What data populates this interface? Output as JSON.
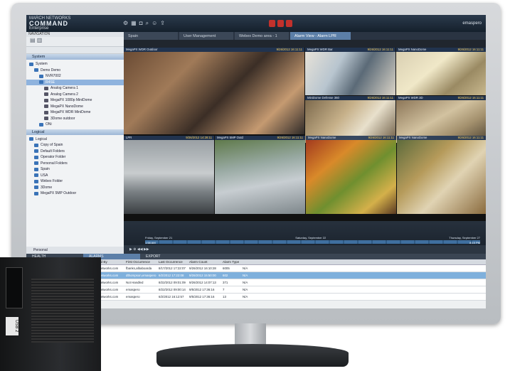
{
  "app": {
    "brand_line1": "MARCH NETWORKS",
    "brand_line2": "COMMAND",
    "brand_line3": "Enterprise",
    "user": "emaspero"
  },
  "tabs": [
    "Spain",
    "User Management",
    "Webex Demo area - 1",
    "Alarm View - Alarm LPR"
  ],
  "navigation": {
    "title": "NAVIGATION",
    "system_section": "System",
    "system_tree": [
      {
        "label": "System",
        "level": 0
      },
      {
        "label": "Demo Demo",
        "level": 1
      },
      {
        "label": "NVR7002",
        "level": 2
      },
      {
        "label": "R4SE",
        "level": 2
      },
      {
        "label": "Analog Camera 1",
        "level": 3
      },
      {
        "label": "Analog Camera 2",
        "level": 3
      },
      {
        "label": "MegaPX 1080p MiniDome",
        "level": 3
      },
      {
        "label": "MegaPX NanoDome",
        "level": 3
      },
      {
        "label": "MegaPX WDR MiniDome",
        "level": 3
      },
      {
        "label": "3Dome outdoor",
        "level": 3
      },
      {
        "label": "ONi",
        "level": 2
      }
    ],
    "system_selected_index": 3,
    "logical_section": "Logical",
    "logical_tree": [
      {
        "label": "Logical",
        "level": 0
      },
      {
        "label": "Copy of Spain",
        "level": 1
      },
      {
        "label": "Default Folders",
        "level": 1
      },
      {
        "label": "Operator Folder",
        "level": 1
      },
      {
        "label": "Personal Folders",
        "level": 1
      },
      {
        "label": "Spain",
        "level": 1
      },
      {
        "label": "USA",
        "level": 1
      },
      {
        "label": "Webex Folder",
        "level": 1
      },
      {
        "label": "3Dome",
        "level": 1
      },
      {
        "label": "MegaPX 5MP Outdoor",
        "level": 1
      }
    ],
    "footer": "Personal"
  },
  "video_tiles": [
    {
      "name": "MegaPX WDR Outdoor",
      "time": "9/26/2012 16:11:11"
    },
    {
      "name": "MegaPX WDR Bar",
      "time": "9/26/2012 16:11:11"
    },
    {
      "name": "MegaPX NanoDome",
      "time": "9/26/2012 16:11:11"
    },
    {
      "name": "MiniDome Defense 360",
      "time": "9/26/2012 16:11:11"
    },
    {
      "name": "MegaPX WDR 3D",
      "time": "9/26/2012 16:11:11"
    },
    {
      "name": "LPR",
      "time": "9/26/2012 14:28:11"
    },
    {
      "name": "MegaPX 5MP Outd",
      "time": "9/26/2012 16:11:11"
    },
    {
      "name": "MegaPX NanoDome",
      "time": "9/26/2012 16:11:11"
    },
    {
      "name": "MegaPX NanoDome",
      "time": "9/26/2012 16:11:11"
    }
  ],
  "timeline": {
    "left_date": "Friday, September 21",
    "mid_date": "Saturday, September 22",
    "right_date": "Thursday, September 27",
    "start_time": "1:58 AM",
    "end_time": "8:15 PM"
  },
  "panels": {
    "tabs": [
      "HEALTH",
      "ALARMS",
      "EXPORT"
    ],
    "columns": [
      "Name",
      "Device",
      "EventName",
      "Handled By",
      "First Occurrence",
      "Last Occurrence",
      "Alarm Count",
      "Alarm Type"
    ],
    "rows": [
      [
        "marchnetworks.com",
        "fbanks,albaboarda",
        "8/17/2012 17:22:07",
        "9/26/2012 16:10:28",
        "6005",
        "N/A"
      ],
      [
        "marchnetworks.com",
        "dthompson,emaspero",
        "6/2/2012 17:22:08",
        "9/26/2012 15:50:00",
        "602",
        "N/A"
      ],
      [
        "marchnetworks.com",
        "Not Handled",
        "8/22/2012 09:01:09",
        "9/26/2012 14:07:13",
        "371",
        "N/A"
      ],
      [
        "marchnetworks.com",
        "emaspero",
        "8/22/2012 09:00:14",
        "9/5/2012 17:36:16",
        "7",
        "N/A"
      ],
      [
        "marchnetworks.com",
        "emaspero",
        "6/2/2012 16:12:57",
        "9/5/2012 17:36:16",
        "13",
        "N/A"
      ]
    ],
    "selected_row": 1
  },
  "server_label": "USB 2",
  "colors": {
    "accent": "#5c7fa8",
    "selection": "#7fb0dc",
    "highlight": "#8fb3de"
  }
}
